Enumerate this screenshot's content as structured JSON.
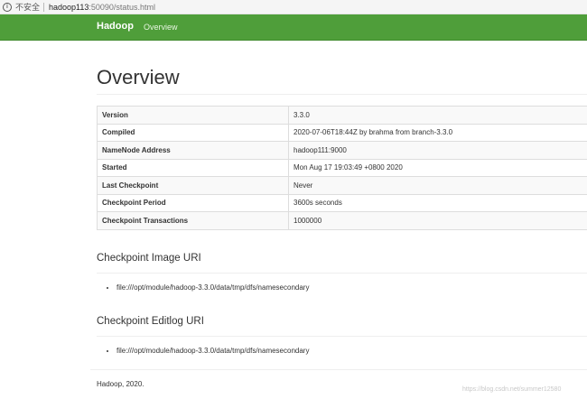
{
  "browser": {
    "security_text": "不安全",
    "url_host": "hadoop113",
    "url_rest": ":50090/status.html"
  },
  "navbar": {
    "brand": "Hadoop",
    "links": [
      "Overview"
    ],
    "color": "#4f9e3a"
  },
  "page": {
    "title": "Overview"
  },
  "overview_table": {
    "rows": [
      {
        "key": "Version",
        "value": "3.3.0"
      },
      {
        "key": "Compiled",
        "value": "2020-07-06T18:44Z by brahma from branch-3.3.0"
      },
      {
        "key": "NameNode Address",
        "value": "hadoop111:9000"
      },
      {
        "key": "Started",
        "value": "Mon Aug 17 19:03:49 +0800 2020"
      },
      {
        "key": "Last Checkpoint",
        "value": "Never"
      },
      {
        "key": "Checkpoint Period",
        "value": "3600s seconds"
      },
      {
        "key": "Checkpoint Transactions",
        "value": "1000000"
      }
    ]
  },
  "checkpoint_image": {
    "title": "Checkpoint Image URI",
    "items": [
      "file:///opt/module/hadoop-3.3.0/data/tmp/dfs/namesecondary"
    ]
  },
  "checkpoint_editlog": {
    "title": "Checkpoint Editlog URI",
    "items": [
      "file:///opt/module/hadoop-3.3.0/data/tmp/dfs/namesecondary"
    ]
  },
  "footer": {
    "text": "Hadoop, 2020."
  },
  "watermark": {
    "text": "https://blog.csdn.net/summer12580"
  }
}
